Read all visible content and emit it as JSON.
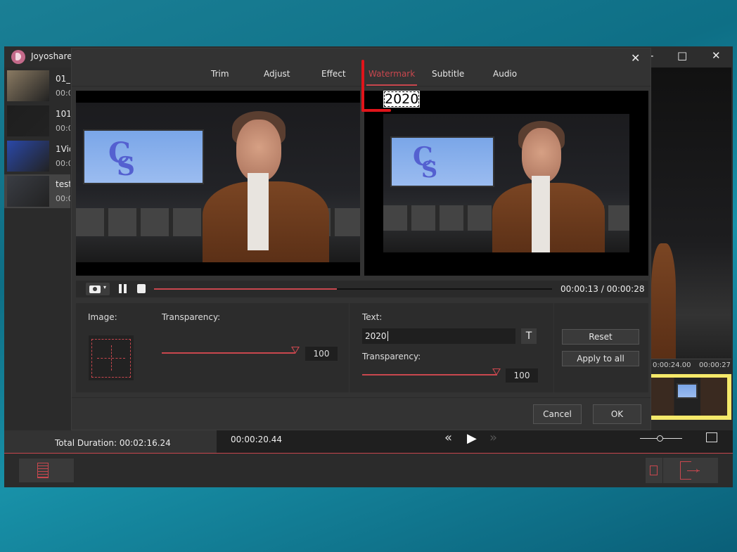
{
  "app": {
    "title": "Joyoshare",
    "window_controls": {
      "minimize": "-",
      "maximize": "□",
      "close": "✕"
    }
  },
  "sidebar": {
    "items": [
      {
        "name": "01_",
        "duration": "00:0",
        "thumb_color": "#8a7a62",
        "selected": false
      },
      {
        "name": "101_",
        "duration": "00:0",
        "thumb_color": "#1e1e1e",
        "selected": false
      },
      {
        "name": "1Vid",
        "duration": "00:0",
        "thumb_color": "#2a48a8",
        "selected": false
      },
      {
        "name": "test",
        "duration": "00:0",
        "thumb_color": "#3a3d44",
        "selected": true
      }
    ]
  },
  "dialog": {
    "close": "✕",
    "tabs": [
      {
        "label": "Trim"
      },
      {
        "label": "Adjust"
      },
      {
        "label": "Effect"
      },
      {
        "label": "Watermark",
        "active": true
      },
      {
        "label": "Subtitle"
      },
      {
        "label": "Audio"
      }
    ],
    "watermark_preview_text": "2020",
    "player": {
      "current": "00:00:13",
      "separator": " / ",
      "total": "00:00:28",
      "progress_fraction": 0.46
    },
    "image_section": {
      "label": "Image:",
      "transparency_label": "Transparency:",
      "transparency_value": "100"
    },
    "text_section": {
      "label": "Text:",
      "text_value": "2020",
      "font_button": "T",
      "transparency_label": "Transparency:",
      "transparency_value": "100"
    },
    "buttons": {
      "reset": "Reset",
      "apply_all": "Apply to all",
      "cancel": "Cancel",
      "ok": "OK"
    }
  },
  "timeline": {
    "tick_1": "0:00:24.00",
    "tick_2": "00:00:27"
  },
  "footer": {
    "total_duration": "Total Duration: 00:02:16.24",
    "current_time": "00:00:20.44"
  },
  "colors": {
    "accent": "#c9474e",
    "clip_highlight": "#f5e96a"
  }
}
